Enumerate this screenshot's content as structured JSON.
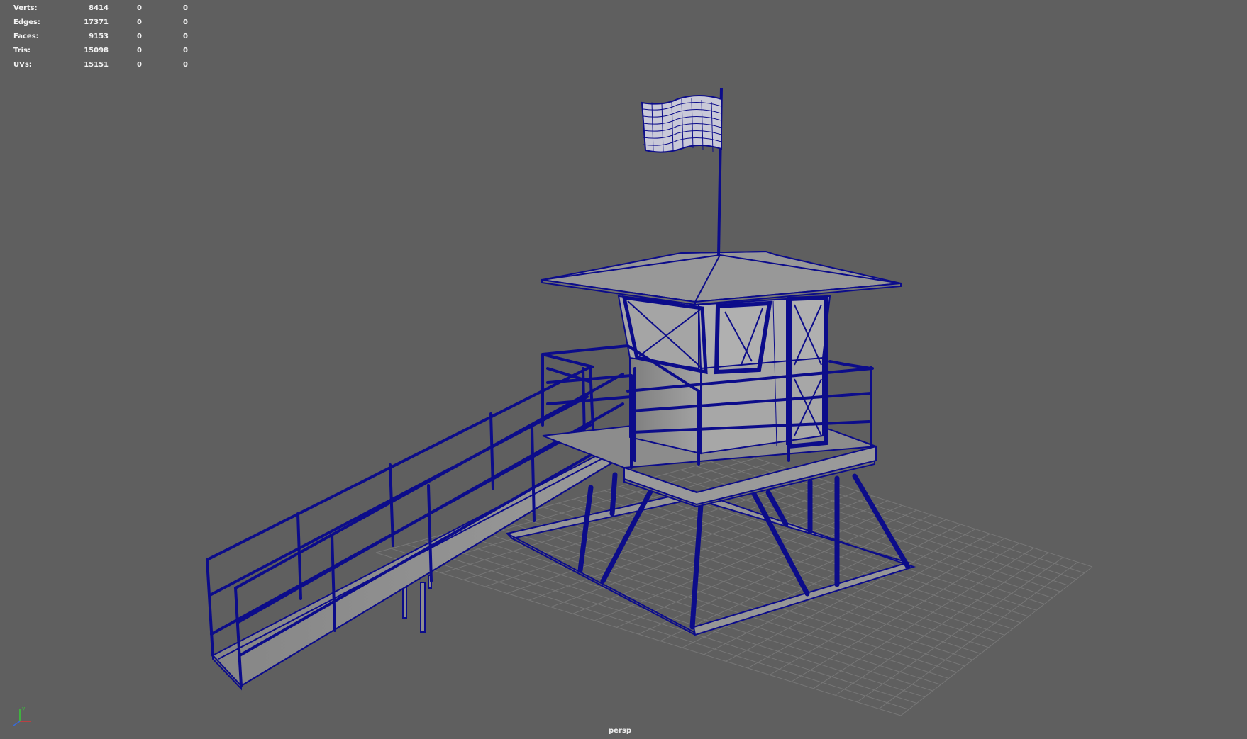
{
  "viewport": {
    "camera": "persp",
    "background_color": "#5f5f5f",
    "wire_color": "#0c0c8a",
    "grid_color": "#777777",
    "surface_color": "#8d8d8d"
  },
  "hud": {
    "rows": [
      {
        "label": "Verts:",
        "v1": "8414",
        "v2": "0",
        "v3": "0"
      },
      {
        "label": "Edges:",
        "v1": "17371",
        "v2": "0",
        "v3": "0"
      },
      {
        "label": "Faces:",
        "v1": "9153",
        "v2": "0",
        "v3": "0"
      },
      {
        "label": "Tris:",
        "v1": "15098",
        "v2": "0",
        "v3": "0"
      },
      {
        "label": "UVs:",
        "v1": "15151",
        "v2": "0",
        "v3": "0"
      }
    ]
  },
  "axis": {
    "y_label": "y",
    "icon": "axis-gizmo-icon"
  }
}
